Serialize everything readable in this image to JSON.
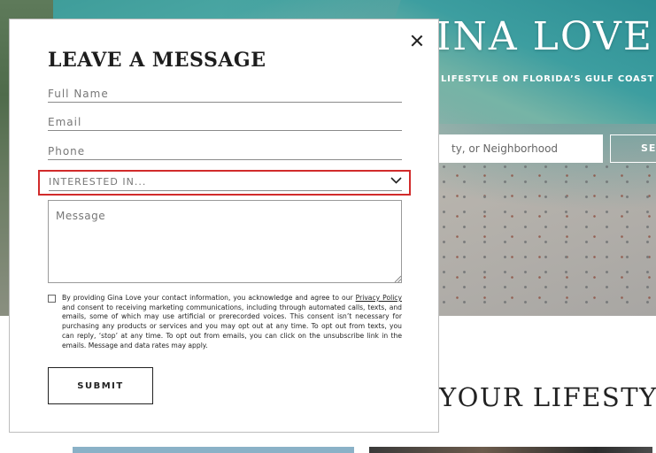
{
  "background": {
    "hero_title": "INA LOVE",
    "tagline": "LIFESTYLE ON FLORIDA’S GULF COAST",
    "search_placeholder": "ty, or Neighborhood",
    "search_button": "SE",
    "section_heading": "YOUR LIFESTYL"
  },
  "modal": {
    "title": "LEAVE A MESSAGE",
    "fields": {
      "full_name_placeholder": "Full Name",
      "email_placeholder": "Email",
      "phone_placeholder": "Phone",
      "message_placeholder": "Message"
    },
    "select": {
      "label": "INTERESTED IN...",
      "highlight_color": "#d12b2b"
    },
    "consent": {
      "checked": false,
      "text_before": "By providing Gina Love your contact information, you acknowledge and agree to our ",
      "link_text": "Privacy Policy",
      "text_after": " and consent to receiving marketing communications, including through automated calls, texts, and emails, some of which may use artificial or prerecorded voices. This consent isn’t necessary for purchasing any products or services and you may opt out at any time. To opt out from texts, you can reply, ‘stop’ at any time. To opt out from emails, you can click on the unsubscribe link in the emails. Message and data rates may apply."
    },
    "submit_label": "SUBMIT",
    "close_icon": "close-icon"
  }
}
